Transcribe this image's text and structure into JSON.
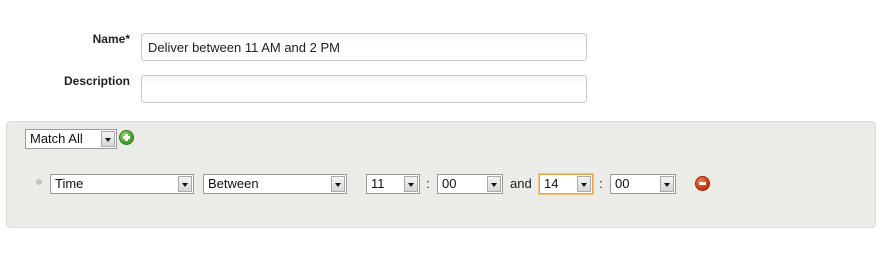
{
  "form": {
    "name_label": "Name*",
    "name_value": "Deliver between 11 AM and 2 PM",
    "description_label": "Description",
    "description_value": ""
  },
  "rules": {
    "match_mode": "Match All",
    "add_icon": "plus-icon",
    "condition": {
      "field": "Time",
      "operator": "Between",
      "start_hour": "11",
      "time_separator": ":",
      "start_minute": "00",
      "connector": "and",
      "end_hour": "14",
      "end_minute": "00",
      "remove_icon": "minus-icon"
    }
  },
  "colors": {
    "panel_background": "#ebebe8",
    "add_icon": "#3f9a23",
    "remove_icon": "#c8320a",
    "focus_border": "#e5a548"
  }
}
